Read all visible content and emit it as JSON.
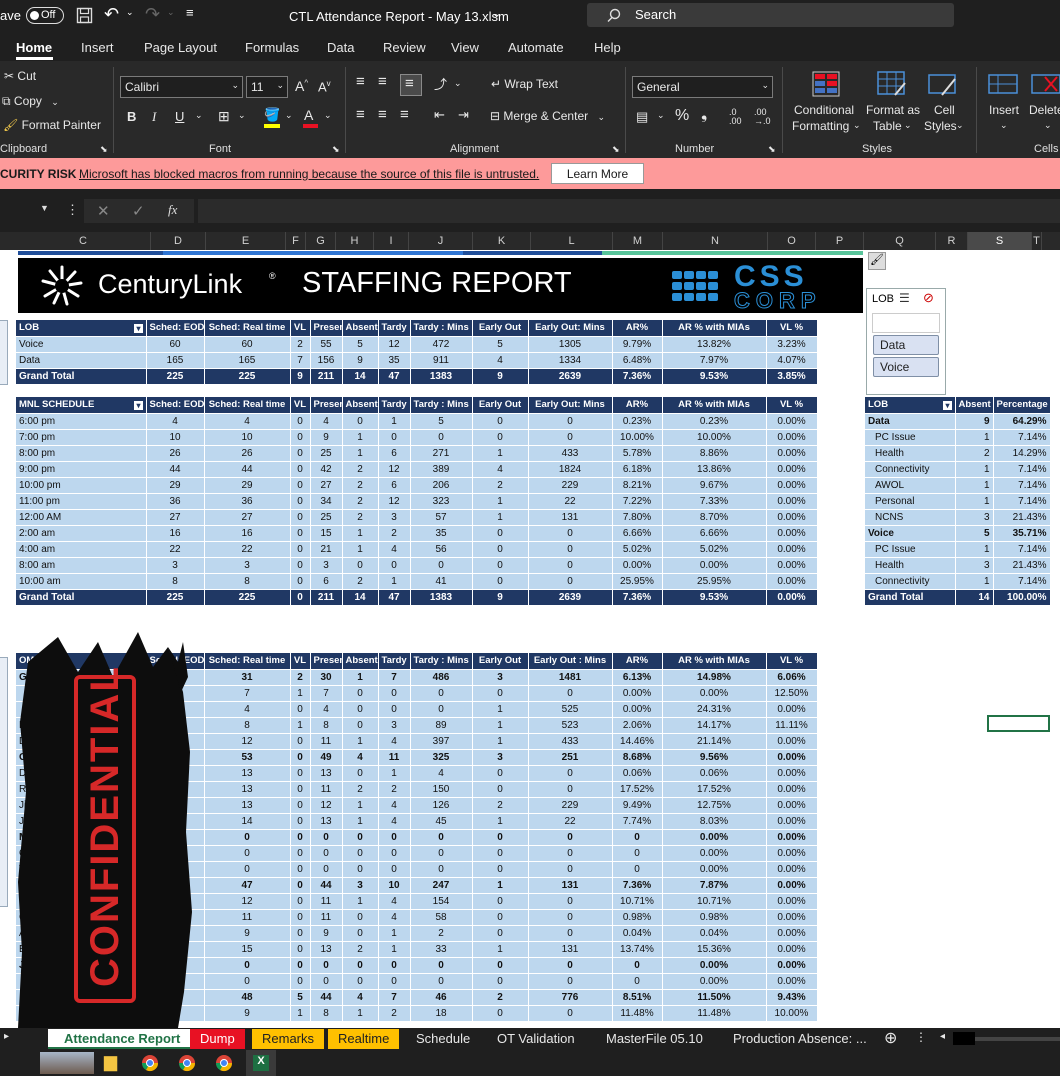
{
  "titlebar": {
    "autosave": "ave",
    "toggle": "Off",
    "filename": "CTL Attendance Report - May 13.xlsm",
    "search": "Search"
  },
  "menu": [
    "Home",
    "Insert",
    "Page Layout",
    "Formulas",
    "Data",
    "Review",
    "View",
    "Automate",
    "Help"
  ],
  "ribbon": {
    "clipboard": {
      "cut": "Cut",
      "copy": "Copy",
      "painter": "Format Painter",
      "label": "Clipboard"
    },
    "font": {
      "name": "Calibri",
      "size": "11",
      "label": "Font"
    },
    "alignment": {
      "wrap": "Wrap Text",
      "merge": "Merge & Center",
      "label": "Alignment"
    },
    "number": {
      "format": "General",
      "label": "Number"
    },
    "styles": {
      "cond1": "Conditional",
      "cond2": "Formatting",
      "fmt1": "Format as",
      "fmt2": "Table",
      "cell1": "Cell",
      "cell2": "Styles",
      "label": "Styles"
    },
    "cells": {
      "insert": "Insert",
      "delete": "Delete",
      "label": "Cells"
    }
  },
  "security": {
    "risk": "CURITY RISK",
    "message": "Microsoft has blocked macros from running because the source of this file is untrusted.",
    "button": "Learn More"
  },
  "columns": [
    {
      "l": "C",
      "w": 135
    },
    {
      "l": "D",
      "w": 55
    },
    {
      "l": "E",
      "w": 80
    },
    {
      "l": "F",
      "w": 20
    },
    {
      "l": "G",
      "w": 30
    },
    {
      "l": "H",
      "w": 38
    },
    {
      "l": "I",
      "w": 35
    },
    {
      "l": "J",
      "w": 64
    },
    {
      "l": "K",
      "w": 58
    },
    {
      "l": "L",
      "w": 82
    },
    {
      "l": "M",
      "w": 50
    },
    {
      "l": "N",
      "w": 105
    },
    {
      "l": "O",
      "w": 48
    },
    {
      "l": "P",
      "w": 48
    },
    {
      "l": "Q",
      "w": 72
    },
    {
      "l": "R",
      "w": 32
    },
    {
      "l": "S",
      "w": 64
    },
    {
      "l": "T",
      "w": 10
    }
  ],
  "banner": {
    "brand": "CenturyLink",
    "trademark": "®",
    "title": "STAFFING REPORT",
    "logo_top": "CSS",
    "logo_bottom": "CORP"
  },
  "lob_table": {
    "headers": [
      "LOB",
      "Sched: EOD",
      "Sched: Real time",
      "VL",
      "Present",
      "Absent",
      "Tardy",
      "Tardy : Mins",
      "Early Out",
      "Early Out: Mins",
      "AR%",
      "AR % with MIAs",
      "VL %"
    ],
    "rows": [
      [
        "Voice",
        "60",
        "60",
        "2",
        "55",
        "5",
        "12",
        "472",
        "5",
        "1305",
        "9.79%",
        "13.82%",
        "3.23%"
      ],
      [
        "Data",
        "165",
        "165",
        "7",
        "156",
        "9",
        "35",
        "911",
        "4",
        "1334",
        "6.48%",
        "7.97%",
        "4.07%"
      ]
    ],
    "total": [
      "Grand Total",
      "225",
      "225",
      "9",
      "211",
      "14",
      "47",
      "1383",
      "9",
      "2639",
      "7.36%",
      "9.53%",
      "3.85%"
    ]
  },
  "mnl_table": {
    "headers": [
      "MNL SCHEDULE",
      "Sched: EOD",
      "Sched: Real time",
      "VL",
      "Present",
      "Absent",
      "Tardy",
      "Tardy : Mins",
      "Early Out",
      "Early Out: Mins",
      "AR%",
      "AR % with MIAs",
      "VL %"
    ],
    "rows": [
      [
        "6:00 pm",
        "4",
        "4",
        "0",
        "4",
        "0",
        "1",
        "5",
        "0",
        "0",
        "0.23%",
        "0.23%",
        "0.00%"
      ],
      [
        "7:00 pm",
        "10",
        "10",
        "0",
        "9",
        "1",
        "0",
        "0",
        "0",
        "0",
        "10.00%",
        "10.00%",
        "0.00%"
      ],
      [
        "8:00 pm",
        "26",
        "26",
        "0",
        "25",
        "1",
        "6",
        "271",
        "1",
        "433",
        "5.78%",
        "8.86%",
        "0.00%"
      ],
      [
        "9:00 pm",
        "44",
        "44",
        "0",
        "42",
        "2",
        "12",
        "389",
        "4",
        "1824",
        "6.18%",
        "13.86%",
        "0.00%"
      ],
      [
        "10:00 pm",
        "29",
        "29",
        "0",
        "27",
        "2",
        "6",
        "206",
        "2",
        "229",
        "8.21%",
        "9.67%",
        "0.00%"
      ],
      [
        "11:00 pm",
        "36",
        "36",
        "0",
        "34",
        "2",
        "12",
        "323",
        "1",
        "22",
        "7.22%",
        "7.33%",
        "0.00%"
      ],
      [
        "12:00 AM",
        "27",
        "27",
        "0",
        "25",
        "2",
        "3",
        "57",
        "1",
        "131",
        "7.80%",
        "8.70%",
        "0.00%"
      ],
      [
        "2:00 am",
        "16",
        "16",
        "0",
        "15",
        "1",
        "2",
        "35",
        "0",
        "0",
        "6.66%",
        "6.66%",
        "0.00%"
      ],
      [
        "4:00 am",
        "22",
        "22",
        "0",
        "21",
        "1",
        "4",
        "56",
        "0",
        "0",
        "5.02%",
        "5.02%",
        "0.00%"
      ],
      [
        "8:00 am",
        "3",
        "3",
        "0",
        "3",
        "0",
        "0",
        "0",
        "0",
        "0",
        "0.00%",
        "0.00%",
        "0.00%"
      ],
      [
        "10:00 am",
        "8",
        "8",
        "0",
        "6",
        "2",
        "1",
        "41",
        "0",
        "0",
        "25.95%",
        "25.95%",
        "0.00%"
      ]
    ],
    "total": [
      "Grand Total",
      "225",
      "225",
      "0",
      "211",
      "14",
      "47",
      "1383",
      "9",
      "2639",
      "7.36%",
      "9.53%",
      "0.00%"
    ]
  },
  "slicer": {
    "title": "LOB",
    "items": [
      "Data",
      "Voice"
    ]
  },
  "reason_table": {
    "headers": [
      "LOB",
      "Absent",
      "Percentage"
    ],
    "rows": [
      {
        "c": [
          "Data",
          "9",
          "64.29%"
        ],
        "b": true
      },
      {
        "c": [
          "PC Issue",
          "1",
          "7.14%"
        ]
      },
      {
        "c": [
          "Health",
          "2",
          "14.29%"
        ]
      },
      {
        "c": [
          "Connectivity",
          "1",
          "7.14%"
        ]
      },
      {
        "c": [
          "AWOL",
          "1",
          "7.14%"
        ]
      },
      {
        "c": [
          "Personal",
          "1",
          "7.14%"
        ]
      },
      {
        "c": [
          "NCNS",
          "3",
          "21.43%"
        ]
      },
      {
        "c": [
          "Voice",
          "5",
          "35.71%"
        ],
        "b": true
      },
      {
        "c": [
          "PC Issue",
          "1",
          "7.14%"
        ]
      },
      {
        "c": [
          "Health",
          "3",
          "21.43%"
        ]
      },
      {
        "c": [
          "Connectivity",
          "1",
          "7.14%"
        ]
      }
    ],
    "total": [
      "Grand Total",
      "14",
      "100.00%"
    ]
  },
  "om_table": {
    "headers": [
      "OM / LEA",
      "Sched: EOD",
      "Sched: Real time",
      "VL",
      "Present",
      "Absent",
      "Tardy",
      "Tardy : Mins",
      "Early Out",
      "Early Out : Mins",
      "AR%",
      "AR % with MIAs",
      "VL %"
    ],
    "rows": [
      {
        "c": [
          "G",
          "31",
          "2",
          "30",
          "1",
          "7",
          "486",
          "3",
          "1481",
          "6.13%",
          "14.98%",
          "6.06%"
        ],
        "b": true
      },
      {
        "c": [
          "",
          "7",
          "1",
          "7",
          "0",
          "0",
          "0",
          "0",
          "0",
          "0.00%",
          "0.00%",
          "12.50%"
        ]
      },
      {
        "c": [
          "",
          "4",
          "0",
          "4",
          "0",
          "0",
          "0",
          "1",
          "525",
          "0.00%",
          "24.31%",
          "0.00%"
        ]
      },
      {
        "c": [
          "R",
          "8",
          "1",
          "8",
          "0",
          "3",
          "89",
          "1",
          "523",
          "2.06%",
          "14.17%",
          "11.11%"
        ]
      },
      {
        "c": [
          "D",
          "12",
          "0",
          "11",
          "1",
          "4",
          "397",
          "1",
          "433",
          "14.46%",
          "21.14%",
          "0.00%"
        ]
      },
      {
        "c": [
          "G",
          "53",
          "0",
          "49",
          "4",
          "11",
          "325",
          "3",
          "251",
          "8.68%",
          "9.56%",
          "0.00%"
        ],
        "b": true
      },
      {
        "c": [
          "D",
          "13",
          "0",
          "13",
          "0",
          "1",
          "4",
          "0",
          "0",
          "0.06%",
          "0.06%",
          "0.00%"
        ]
      },
      {
        "c": [
          "R",
          "13",
          "0",
          "11",
          "2",
          "2",
          "150",
          "0",
          "0",
          "17.52%",
          "17.52%",
          "0.00%"
        ]
      },
      {
        "c": [
          "Ji",
          "13",
          "0",
          "12",
          "1",
          "4",
          "126",
          "2",
          "229",
          "9.49%",
          "12.75%",
          "0.00%"
        ]
      },
      {
        "c": [
          "Ja",
          "14",
          "0",
          "13",
          "1",
          "4",
          "45",
          "1",
          "22",
          "7.74%",
          "8.03%",
          "0.00%"
        ]
      },
      {
        "c": [
          "M",
          "0",
          "0",
          "0",
          "0",
          "0",
          "0",
          "0",
          "0",
          "0",
          "0.00%",
          "0.00%"
        ],
        "b": true
      },
      {
        "c": [
          "Cl",
          "0",
          "0",
          "0",
          "0",
          "0",
          "0",
          "0",
          "0",
          "0",
          "0.00%",
          "0.00%"
        ]
      },
      {
        "c": [
          "V",
          "0",
          "0",
          "0",
          "0",
          "0",
          "0",
          "0",
          "0",
          "0",
          "0.00%",
          "0.00%"
        ]
      },
      {
        "c": [
          "Ja",
          "47",
          "0",
          "44",
          "3",
          "10",
          "247",
          "1",
          "131",
          "7.36%",
          "7.87%",
          "0.00%"
        ],
        "b": true
      },
      {
        "c": [
          "V",
          "12",
          "0",
          "11",
          "1",
          "4",
          "154",
          "0",
          "0",
          "10.71%",
          "10.71%",
          "0.00%"
        ]
      },
      {
        "c": [
          "G",
          "11",
          "0",
          "11",
          "0",
          "4",
          "58",
          "0",
          "0",
          "0.98%",
          "0.98%",
          "0.00%"
        ]
      },
      {
        "c": [
          "A",
          "9",
          "0",
          "9",
          "0",
          "1",
          "2",
          "0",
          "0",
          "0.04%",
          "0.04%",
          "0.00%"
        ]
      },
      {
        "c": [
          "Ea",
          "15",
          "0",
          "13",
          "2",
          "1",
          "33",
          "1",
          "131",
          "13.74%",
          "15.36%",
          "0.00%"
        ]
      },
      {
        "c": [
          "Jo",
          "0",
          "0",
          "0",
          "0",
          "0",
          "0",
          "0",
          "0",
          "0",
          "0.00%",
          "0.00%"
        ],
        "b": true
      },
      {
        "c": [
          "",
          "0",
          "0",
          "0",
          "0",
          "0",
          "0",
          "0",
          "0",
          "0",
          "0.00%",
          "0.00%"
        ]
      },
      {
        "c": [
          "",
          "48",
          "5",
          "44",
          "4",
          "7",
          "46",
          "2",
          "776",
          "8.51%",
          "11.50%",
          "9.43%"
        ],
        "b": true
      },
      {
        "c": [
          "",
          "9",
          "1",
          "8",
          "1",
          "2",
          "18",
          "0",
          "0",
          "11.48%",
          "11.48%",
          "10.00%"
        ]
      }
    ]
  },
  "watermark": "CONFIDENTIAL",
  "sheets": [
    "Attendance Report",
    "Dump",
    "Remarks",
    "Realtime",
    "Schedule",
    "OT Validation",
    "MasterFile 05.10",
    "Production Absence: ..."
  ],
  "sheet_colors": {
    "Dump": "#e81123",
    "Remarks": "#ffc000",
    "Realtime": "#ffc000"
  }
}
